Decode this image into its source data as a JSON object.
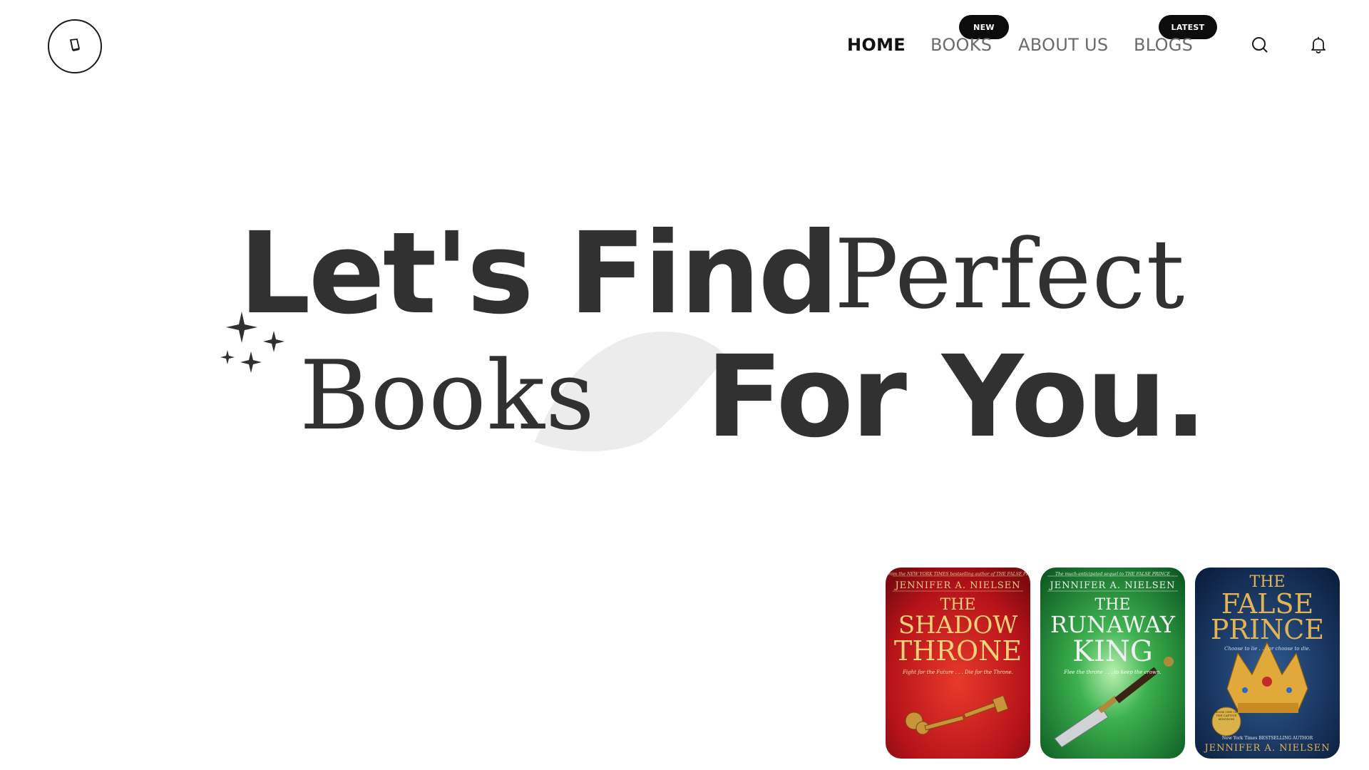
{
  "header": {
    "nav": [
      {
        "label": "HOME",
        "active": true
      },
      {
        "label": "BOOKS",
        "active": false,
        "badge": "NEW"
      },
      {
        "label": "ABOUT US",
        "active": false
      },
      {
        "label": "BLOGS",
        "active": false,
        "badge": "LATEST"
      }
    ],
    "icons": [
      "book-logo-icon",
      "search-icon",
      "bell-icon"
    ]
  },
  "hero": {
    "line1": {
      "heavy": "Let's Find",
      "light": "Perfect"
    },
    "line2": {
      "light": "Books",
      "heavy": "For You."
    }
  },
  "books": [
    {
      "tagline": "From the NEW YORK TIMES bestselling author of THE FALSE PRINCE",
      "author": "JENNIFER A. NIELSEN",
      "title_lines": [
        "THE",
        "SHADOW",
        "THRONE"
      ],
      "subtitle": "Fight for the Future . . . Die for the Throne.",
      "color": "#c0141b"
    },
    {
      "tagline": "The much-anticipated sequel to THE FALSE PRINCE",
      "author": "JENNIFER A. NIELSEN",
      "title_lines": [
        "THE",
        "RUNAWAY",
        "KING"
      ],
      "subtitle": "Flee the throne . . . to keep the crown.",
      "color": "#1e8a3a"
    },
    {
      "title_lines": [
        "THE",
        "FALSE",
        "PRINCE"
      ],
      "subtitle": "Choose to lie . . . or choose to die.",
      "medal": "BOOK ONE OF THE CAPTIVE KINGDOM",
      "bottom_tagline": "New York Times BESTSELLING AUTHOR",
      "author": "JENNIFER A. NIELSEN",
      "color": "#14305c"
    }
  ],
  "colors": {
    "text_dark": "#313131",
    "nav_muted": "#6b6b6b",
    "badge_bg": "#0c0c0c",
    "leaf": "#ececec"
  }
}
